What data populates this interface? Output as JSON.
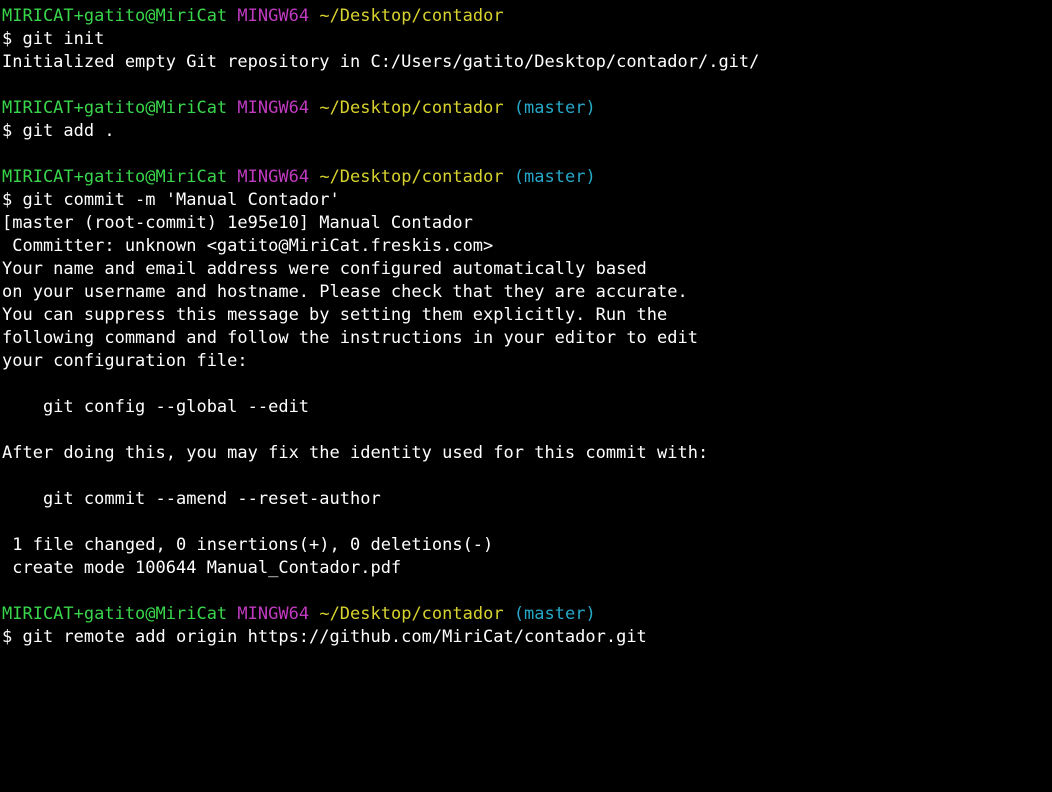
{
  "terminal": {
    "background": "#000000",
    "colors": {
      "user_host": "#39d54b",
      "shell": "#c03ac0",
      "path": "#d8d22f",
      "branch": "#26a9c9",
      "text": "#ffffff"
    },
    "lines": [
      {
        "kind": "prompt",
        "user": "MIRICAT+gatito@MiriCat",
        "shell": "MINGW64",
        "path": "~/Desktop/contador",
        "branch": ""
      },
      {
        "kind": "text",
        "text": "$ git init"
      },
      {
        "kind": "text",
        "text": "Initialized empty Git repository in C:/Users/gatito/Desktop/contador/.git/"
      },
      {
        "kind": "blank",
        "text": ""
      },
      {
        "kind": "prompt",
        "user": "MIRICAT+gatito@MiriCat",
        "shell": "MINGW64",
        "path": "~/Desktop/contador",
        "branch": "(master)"
      },
      {
        "kind": "text",
        "text": "$ git add ."
      },
      {
        "kind": "blank",
        "text": ""
      },
      {
        "kind": "prompt",
        "user": "MIRICAT+gatito@MiriCat",
        "shell": "MINGW64",
        "path": "~/Desktop/contador",
        "branch": "(master)"
      },
      {
        "kind": "text",
        "text": "$ git commit -m 'Manual Contador'"
      },
      {
        "kind": "text",
        "text": "[master (root-commit) 1e95e10] Manual Contador"
      },
      {
        "kind": "text",
        "text": " Committer: unknown <gatito@MiriCat.freskis.com>"
      },
      {
        "kind": "text",
        "text": "Your name and email address were configured automatically based"
      },
      {
        "kind": "text",
        "text": "on your username and hostname. Please check that they are accurate."
      },
      {
        "kind": "text",
        "text": "You can suppress this message by setting them explicitly. Run the"
      },
      {
        "kind": "text",
        "text": "following command and follow the instructions in your editor to edit"
      },
      {
        "kind": "text",
        "text": "your configuration file:"
      },
      {
        "kind": "blank",
        "text": ""
      },
      {
        "kind": "text",
        "text": "    git config --global --edit"
      },
      {
        "kind": "blank",
        "text": ""
      },
      {
        "kind": "text",
        "text": "After doing this, you may fix the identity used for this commit with:"
      },
      {
        "kind": "blank",
        "text": ""
      },
      {
        "kind": "text",
        "text": "    git commit --amend --reset-author"
      },
      {
        "kind": "blank",
        "text": ""
      },
      {
        "kind": "text",
        "text": " 1 file changed, 0 insertions(+), 0 deletions(-)"
      },
      {
        "kind": "text",
        "text": " create mode 100644 Manual_Contador.pdf"
      },
      {
        "kind": "blank",
        "text": ""
      },
      {
        "kind": "prompt",
        "user": "MIRICAT+gatito@MiriCat",
        "shell": "MINGW64",
        "path": "~/Desktop/contador",
        "branch": "(master)"
      },
      {
        "kind": "text",
        "text": "$ git remote add origin https://github.com/MiriCat/contador.git"
      }
    ]
  }
}
